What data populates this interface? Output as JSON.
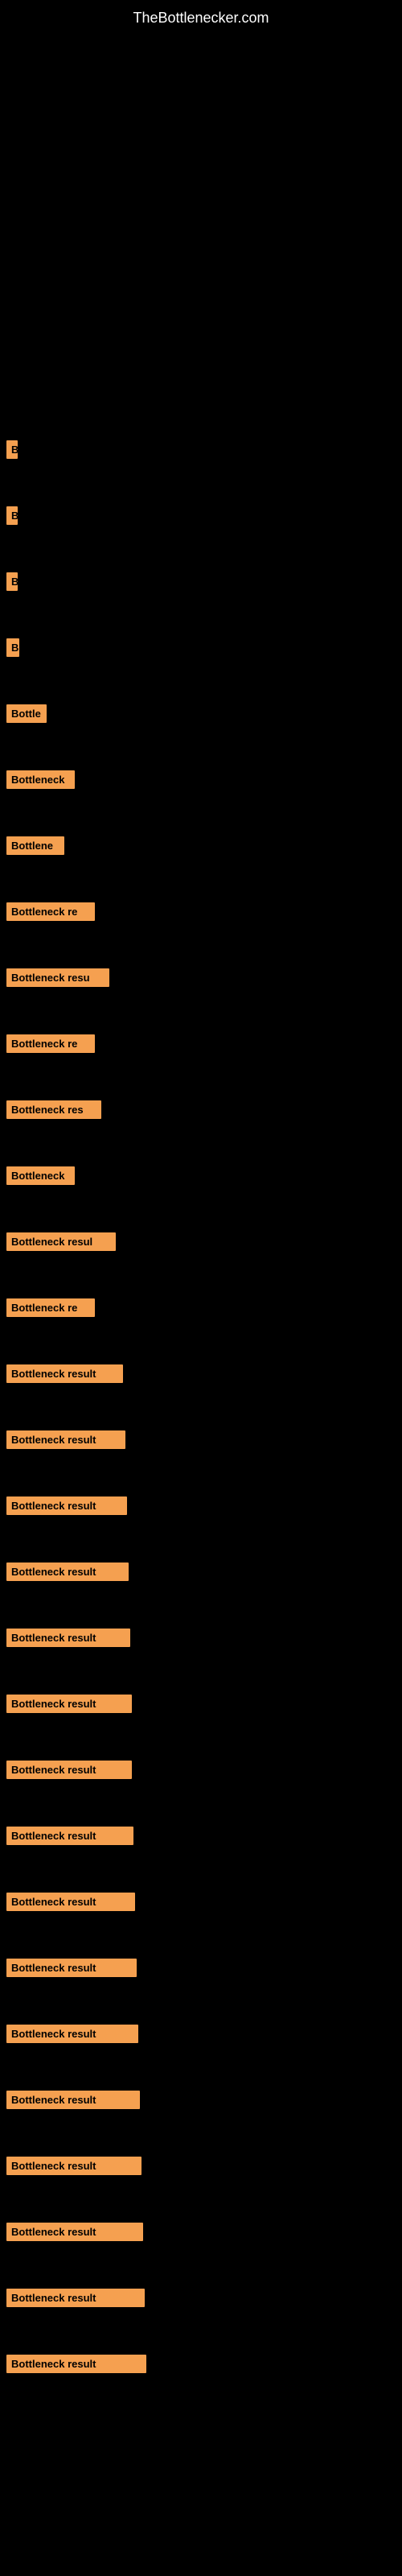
{
  "site": {
    "title": "TheBottlenecker.com"
  },
  "bars": [
    {
      "label": "Bottleneck result",
      "width": 14
    },
    {
      "label": "B",
      "width": 14
    },
    {
      "label": "B",
      "width": 14
    },
    {
      "label": "B",
      "width": 16
    },
    {
      "label": "Bottle",
      "width": 50
    },
    {
      "label": "Bottleneck",
      "width": 85
    },
    {
      "label": "Bottlene",
      "width": 72
    },
    {
      "label": "Bottleneck re",
      "width": 110
    },
    {
      "label": "Bottleneck resu",
      "width": 128
    },
    {
      "label": "Bottleneck re",
      "width": 110
    },
    {
      "label": "Bottleneck res",
      "width": 118
    },
    {
      "label": "Bottleneck",
      "width": 85
    },
    {
      "label": "Bottleneck resul",
      "width": 136
    },
    {
      "label": "Bottleneck re",
      "width": 110
    },
    {
      "label": "Bottleneck result",
      "width": 145
    },
    {
      "label": "Bottleneck result",
      "width": 148
    },
    {
      "label": "Bottleneck result",
      "width": 150
    },
    {
      "label": "Bottleneck result",
      "width": 152
    },
    {
      "label": "Bottleneck result",
      "width": 154
    },
    {
      "label": "Bottleneck result",
      "width": 156
    },
    {
      "label": "Bottleneck result",
      "width": 156
    },
    {
      "label": "Bottleneck result",
      "width": 158
    },
    {
      "label": "Bottleneck result",
      "width": 160
    },
    {
      "label": "Bottleneck result",
      "width": 162
    },
    {
      "label": "Bottleneck result",
      "width": 164
    },
    {
      "label": "Bottleneck result",
      "width": 166
    },
    {
      "label": "Bottleneck result",
      "width": 168
    },
    {
      "label": "Bottleneck result",
      "width": 170
    },
    {
      "label": "Bottleneck result",
      "width": 172
    },
    {
      "label": "Bottleneck result",
      "width": 174
    }
  ]
}
